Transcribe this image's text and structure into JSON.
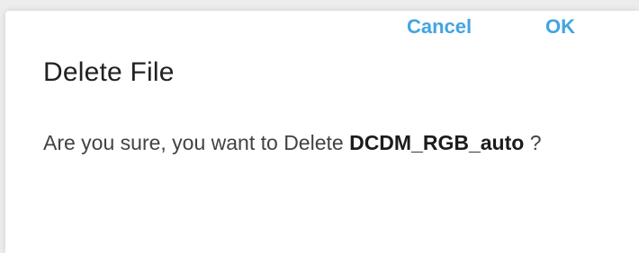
{
  "dialog": {
    "title": "Delete File",
    "message_prefix": "Are you sure, you want to Delete ",
    "filename": "DCDM_RGB_auto",
    "message_suffix": " ?",
    "cancel_label": "Cancel",
    "ok_label": "OK"
  },
  "colors": {
    "accent": "#42a5e0",
    "title": "#212121",
    "text": "#424242"
  }
}
